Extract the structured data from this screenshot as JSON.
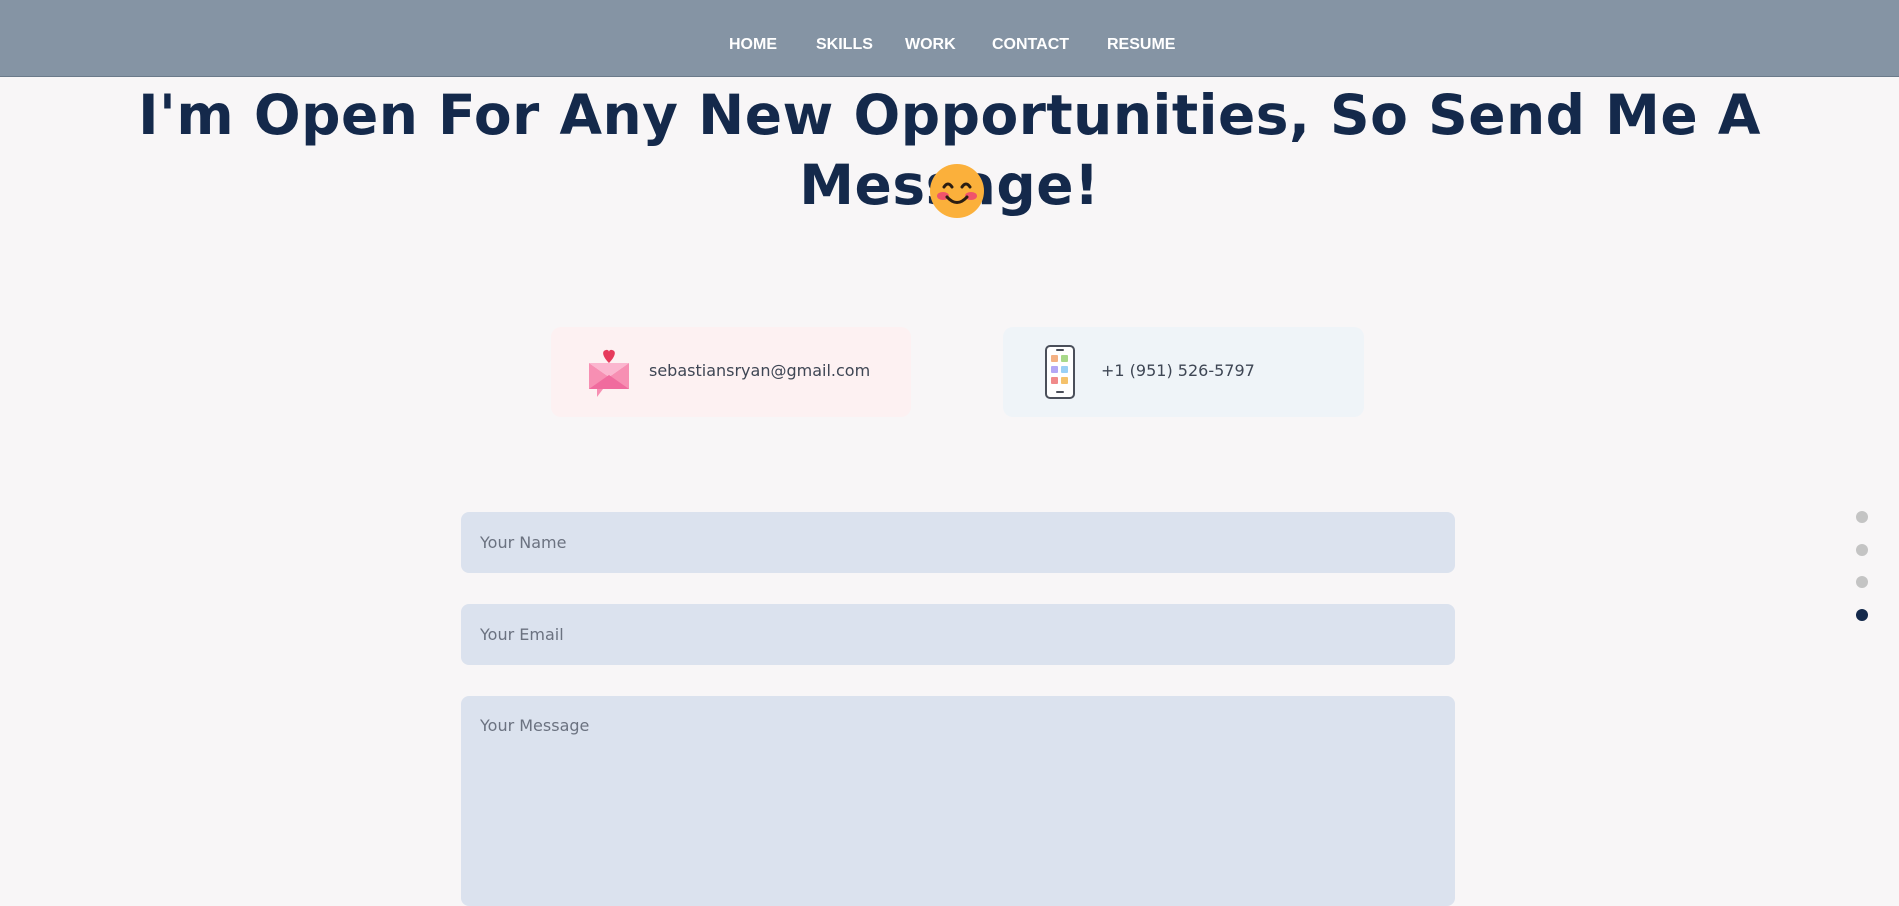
{
  "nav": {
    "items": [
      {
        "label": "HOME"
      },
      {
        "label": "SKILLS"
      },
      {
        "label": "WORK"
      },
      {
        "label": "CONTACT"
      },
      {
        "label": "RESUME"
      }
    ]
  },
  "hero": {
    "heading": "I'm Open For Any New Opportunities, So Send Me A Message!",
    "emoji_icon": "smiling-face-emoji"
  },
  "contact": {
    "email": {
      "icon": "love-letter-icon",
      "text": "sebastiansryan@gmail.com"
    },
    "phone": {
      "icon": "smartphone-icon",
      "text": "+1 (951) 526-5797"
    }
  },
  "form": {
    "name_placeholder": "Your Name",
    "email_placeholder": "Your Email",
    "message_placeholder": "Your Message"
  },
  "section_nav": {
    "count": 4,
    "active_index": 3
  },
  "colors": {
    "navbar": "#8594a4",
    "heading": "#14294b",
    "field_bg": "#dbe2ee",
    "dot_active": "#14294b",
    "dot_inactive": "#c4c4c4"
  }
}
